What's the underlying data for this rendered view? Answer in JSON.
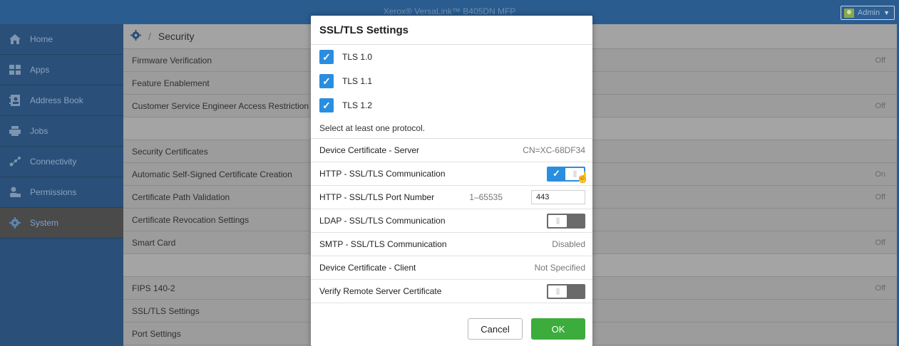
{
  "header": {
    "title": "Xerox® VersaLink™ B405DN MFP",
    "admin_label": "Admin"
  },
  "sidebar": {
    "items": [
      {
        "label": "Home",
        "icon": "home-icon"
      },
      {
        "label": "Apps",
        "icon": "apps-icon"
      },
      {
        "label": "Address Book",
        "icon": "address-book-icon"
      },
      {
        "label": "Jobs",
        "icon": "jobs-icon"
      },
      {
        "label": "Connectivity",
        "icon": "connectivity-icon"
      },
      {
        "label": "Permissions",
        "icon": "permissions-icon"
      },
      {
        "label": "System",
        "icon": "gear-icon",
        "active": true
      }
    ]
  },
  "breadcrumb": {
    "current": "Security"
  },
  "list": {
    "rows": [
      {
        "label": "Firmware Verification",
        "value": "Off"
      },
      {
        "label": "Feature Enablement",
        "value": ""
      },
      {
        "label": "Customer Service Engineer Access Restriction",
        "value": "Off"
      },
      {
        "label": "",
        "value": ""
      },
      {
        "label": "Security Certificates",
        "value": ""
      },
      {
        "label": "Automatic Self-Signed Certificate Creation",
        "value": "On"
      },
      {
        "label": "Certificate Path Validation",
        "value": "Off"
      },
      {
        "label": "Certificate Revocation Settings",
        "value": ""
      },
      {
        "label": "Smart Card",
        "value": "Off"
      },
      {
        "label": "",
        "value": ""
      },
      {
        "label": "FIPS 140-2",
        "value": "Off"
      },
      {
        "label": "SSL/TLS Settings",
        "value": ""
      },
      {
        "label": "Port Settings",
        "value": ""
      }
    ]
  },
  "dialog": {
    "title": "SSL/TLS Settings",
    "protocols": [
      {
        "label": "TLS 1.0",
        "checked": true
      },
      {
        "label": "TLS 1.1",
        "checked": true
      },
      {
        "label": "TLS 1.2",
        "checked": true
      }
    ],
    "hint": "Select at least one protocol.",
    "device_cert_server_label": "Device Certificate - Server",
    "device_cert_server_value": "CN=XC-68DF34",
    "http_ssl_label": "HTTP - SSL/TLS Communication",
    "http_ssl_on": true,
    "http_port_label": "HTTP - SSL/TLS Port Number",
    "http_port_range": "1–65535",
    "http_port_value": "443",
    "ldap_ssl_label": "LDAP - SSL/TLS Communication",
    "ldap_ssl_on": false,
    "smtp_ssl_label": "SMTP - SSL/TLS Communication",
    "smtp_ssl_value": "Disabled",
    "device_cert_client_label": "Device Certificate - Client",
    "device_cert_client_value": "Not Specified",
    "verify_remote_label": "Verify Remote Server Certificate",
    "verify_remote_on": false,
    "cancel_label": "Cancel",
    "ok_label": "OK"
  },
  "colors": {
    "accent": "#2a8ee0",
    "ok_button": "#3cac3c",
    "topbar": "#2b5c8f"
  }
}
